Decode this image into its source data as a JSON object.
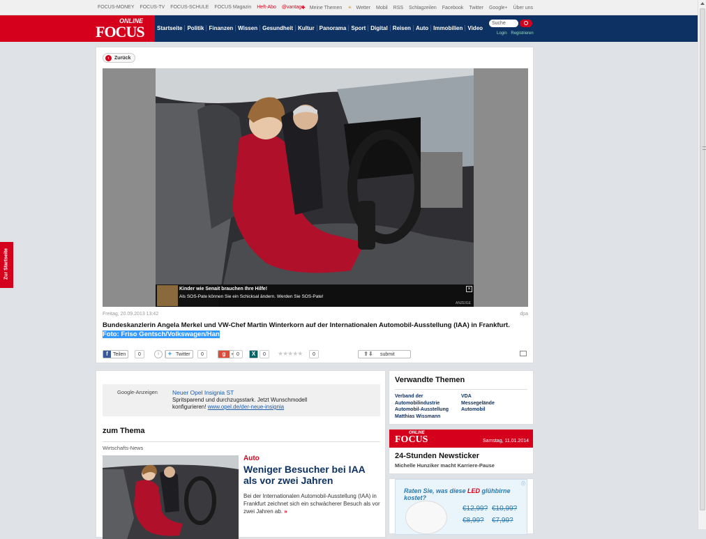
{
  "topbar": {
    "left_links": [
      "FOCUS-MONEY",
      "FOCUS-TV",
      "FOCUS-SCHULE",
      "FOCUS Magazin",
      "Heft-Abo",
      "@vantage"
    ],
    "right_links": [
      "Meine Themen",
      "Wetter",
      "Mobil",
      "RSS",
      "Schlagzeilen",
      "Facebook",
      "Twitter",
      "Google+",
      "Über uns"
    ]
  },
  "logo": {
    "online": "ONLINE",
    "focus": "FOCUS"
  },
  "nav": [
    "Startseite",
    "Politik",
    "Finanzen",
    "Wissen",
    "Gesundheit",
    "Kultur",
    "Panorama",
    "Sport",
    "Digital",
    "Reisen",
    "Auto",
    "Immobilien",
    "Video"
  ],
  "search": {
    "placeholder": "Suche"
  },
  "login": {
    "login": "Login",
    "register": "Registrieren"
  },
  "sidetab": "Zur Startseite",
  "gallery": {
    "back": "Zurück",
    "ad_title": "Kinder wie Senait brauchen Ihre Hilfe!",
    "ad_text": "Als SOS-Pate können Sie ein Schicksal ändern. Werden Sie SOS-Pate!",
    "ad_label": "ANZEIGE",
    "date": "Freitag, 20.09.2013 13:42",
    "source": "dpa",
    "caption": "Bundeskanzlerin Angela Merkel und VW-Chef Martin Winterkorn auf der Internationalen Automobil-Ausstellung (IAA) in Frankfurt.",
    "photo_credit": "Foto: Friso Gentsch/Volkswagen/Han"
  },
  "social": {
    "facebook": "Teilen",
    "facebook_count": "0",
    "info_count": "0",
    "twitter": "Twitter",
    "twitter_count": "0",
    "gplus": "+1",
    "gplus_count": "0",
    "xing_count": "0",
    "rating_count": "0",
    "submit": "submit"
  },
  "gads": {
    "label": "Google-Anzeigen",
    "title": "Neuer Opel Insignia ST",
    "desc": "Spritsparend und durchzugsstark. Jetzt Wunschmodell konfigurieren!",
    "url": "www.opel.de/der-neue-insignia"
  },
  "zum_thema": {
    "heading": "zum Thema",
    "category": "Wirtschafts-News",
    "kicker": "Auto",
    "title": "Weniger Besucher bei IAA als vor zwei Jahren",
    "teaser": "Bei der Internationalen Automobil-Ausstellung (IAA) in Frankfurt zeichnet sich ein schwächerer Besuch als vor zwei Jahren ab.",
    "more": "»"
  },
  "verwandt": {
    "heading": "Verwandte Themen",
    "col1": [
      "Verband der Automobilindustrie",
      "Automobil-Ausstellung",
      "Matthias Wissmann"
    ],
    "col2": [
      "VDA",
      "Messegelände",
      "Automobil"
    ]
  },
  "newsticker": {
    "online": "ONLINE",
    "focus": "FOCUS",
    "date": "Samstag, 11.01.2014",
    "title": "24-Stunden Newsticker",
    "sub": "Michelle Hunziker macht Karriere-Pause"
  },
  "ad": {
    "headline_a": "Raten Sie, was diese ",
    "headline_b": "LED",
    "headline_c": " glühbirne kostet?",
    "prices": [
      "€12,99?",
      "€10,99?",
      "€8,99?",
      "€7,99?"
    ]
  },
  "colors": {
    "brand_red": "#d5001c",
    "nav_blue": "#0d3163",
    "selection": "#3399ff"
  }
}
